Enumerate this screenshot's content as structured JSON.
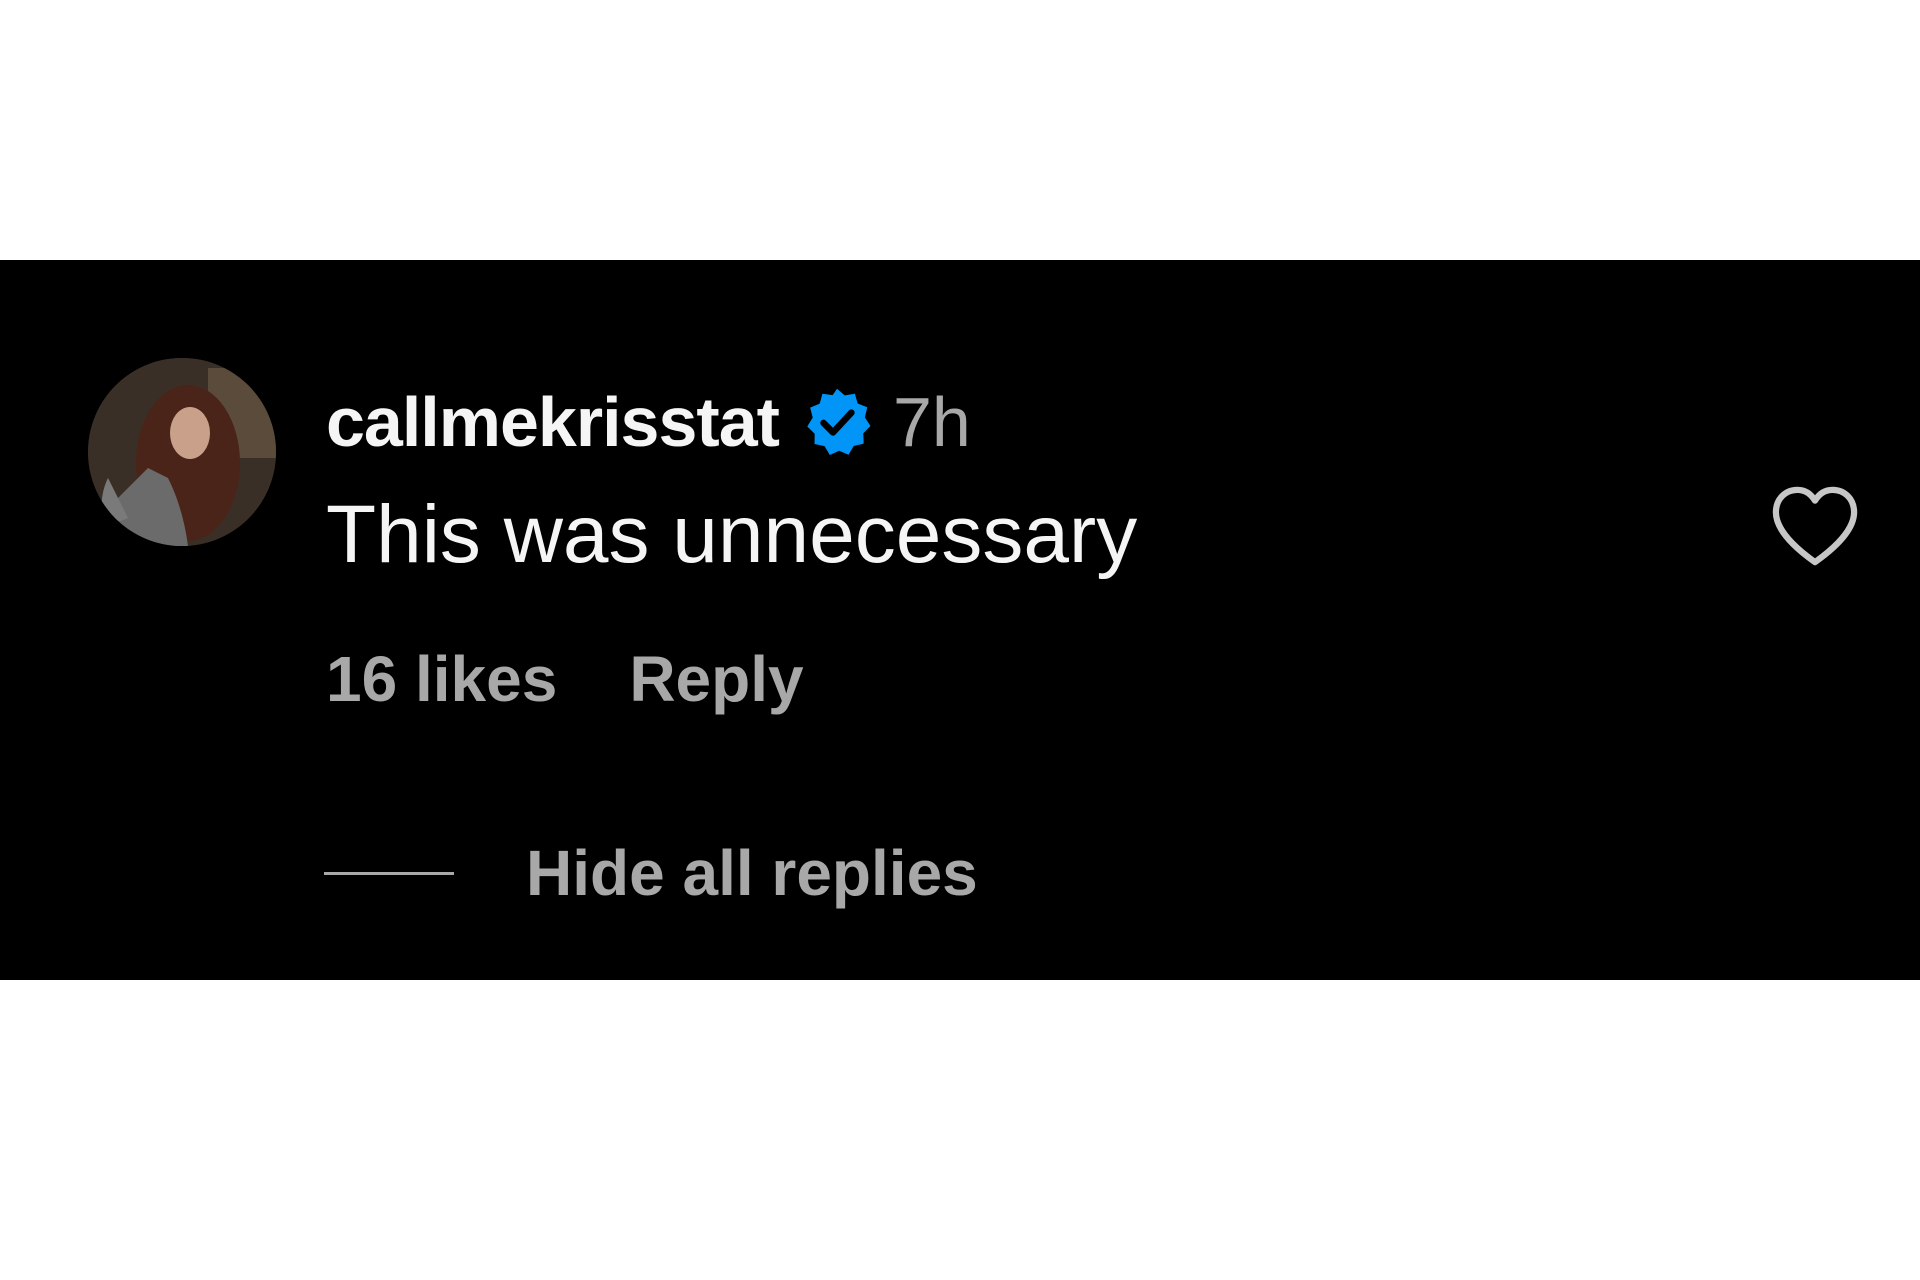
{
  "comment": {
    "username": "callmekrisstat",
    "verified": true,
    "verified_icon": "verified-badge-icon",
    "verified_color": "#0095f6",
    "timestamp": "7h",
    "text": "This was unnecessary",
    "likes_label": "16 likes",
    "reply_label": "Reply",
    "like_icon": "heart-outline-icon"
  },
  "replies": {
    "toggle_label": "Hide all replies"
  },
  "colors": {
    "panel_background": "#000000",
    "page_background": "#ffffff",
    "primary_text": "#f5f5f5",
    "secondary_text": "#a8a8a8"
  }
}
